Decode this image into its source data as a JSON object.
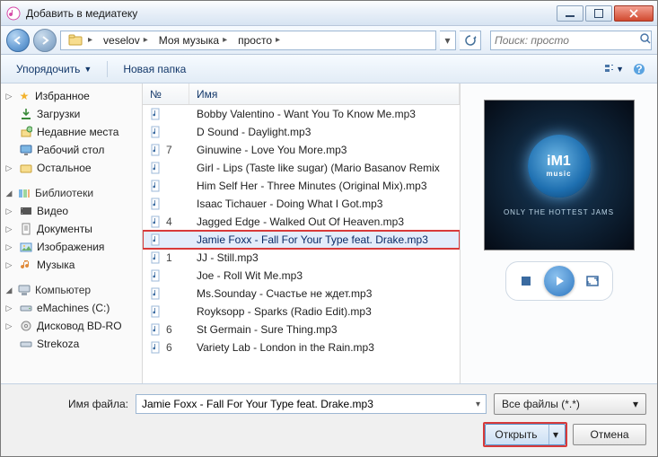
{
  "window": {
    "title": "Добавить в медиатеку"
  },
  "nav": {
    "crumbs": [
      "veselov",
      "Моя музыка",
      "просто"
    ],
    "search_placeholder": "Поиск: просто"
  },
  "toolbar": {
    "organize": "Упорядочить",
    "new_folder": "Новая папка"
  },
  "sidebar": {
    "favorites": {
      "label": "Избранное",
      "items": [
        {
          "label": "Загрузки"
        },
        {
          "label": "Недавние места"
        },
        {
          "label": "Рабочий стол"
        },
        {
          "label": "Остальное"
        }
      ]
    },
    "libraries": {
      "label": "Библиотеки",
      "items": [
        {
          "label": "Видео"
        },
        {
          "label": "Документы"
        },
        {
          "label": "Изображения"
        },
        {
          "label": "Музыка"
        }
      ]
    },
    "computer": {
      "label": "Компьютер",
      "items": [
        {
          "label": "eMachines (C:)"
        },
        {
          "label": "Дисковод BD-RO"
        },
        {
          "label": "Strekoza"
        }
      ]
    }
  },
  "columns": {
    "num": "№",
    "name": "Имя"
  },
  "files": [
    {
      "num": "",
      "name": "Bobby Valentino - Want You To Know Me.mp3"
    },
    {
      "num": "",
      "name": "D Sound - Daylight.mp3"
    },
    {
      "num": "7",
      "name": "Ginuwine - Love You More.mp3"
    },
    {
      "num": "",
      "name": "Girl - Lips (Taste like sugar) (Mario Basanov Remix"
    },
    {
      "num": "",
      "name": "Him Self Her - Three Minutes (Original Mix).mp3"
    },
    {
      "num": "",
      "name": "Isaac Tichauer - Doing What I Got.mp3"
    },
    {
      "num": "4",
      "name": "Jagged Edge - Walked Out Of Heaven.mp3"
    },
    {
      "num": "",
      "name": "Jamie Foxx - Fall For Your Type feat. Drake.mp3",
      "selected": true
    },
    {
      "num": "1",
      "name": "JJ - Still.mp3"
    },
    {
      "num": "",
      "name": "Joe - Roll Wit Me.mp3"
    },
    {
      "num": "",
      "name": "Ms.Sounday - Счастье не ждет.mp3"
    },
    {
      "num": "",
      "name": "Royksopp - Sparks (Radio Edit).mp3"
    },
    {
      "num": "6",
      "name": "St Germain - Sure Thing.mp3"
    },
    {
      "num": "6",
      "name": "Variety Lab - London in the Rain.mp3"
    }
  ],
  "preview": {
    "logo_top": "iM1",
    "logo_bottom": "music",
    "tagline": "ONLY THE HOTTEST JAMS"
  },
  "footer": {
    "filename_label": "Имя файла:",
    "filename_value": "Jamie Foxx - Fall For Your Type feat. Drake.mp3",
    "type_filter": "Все файлы (*.*)",
    "open": "Открыть",
    "cancel": "Отмена"
  }
}
